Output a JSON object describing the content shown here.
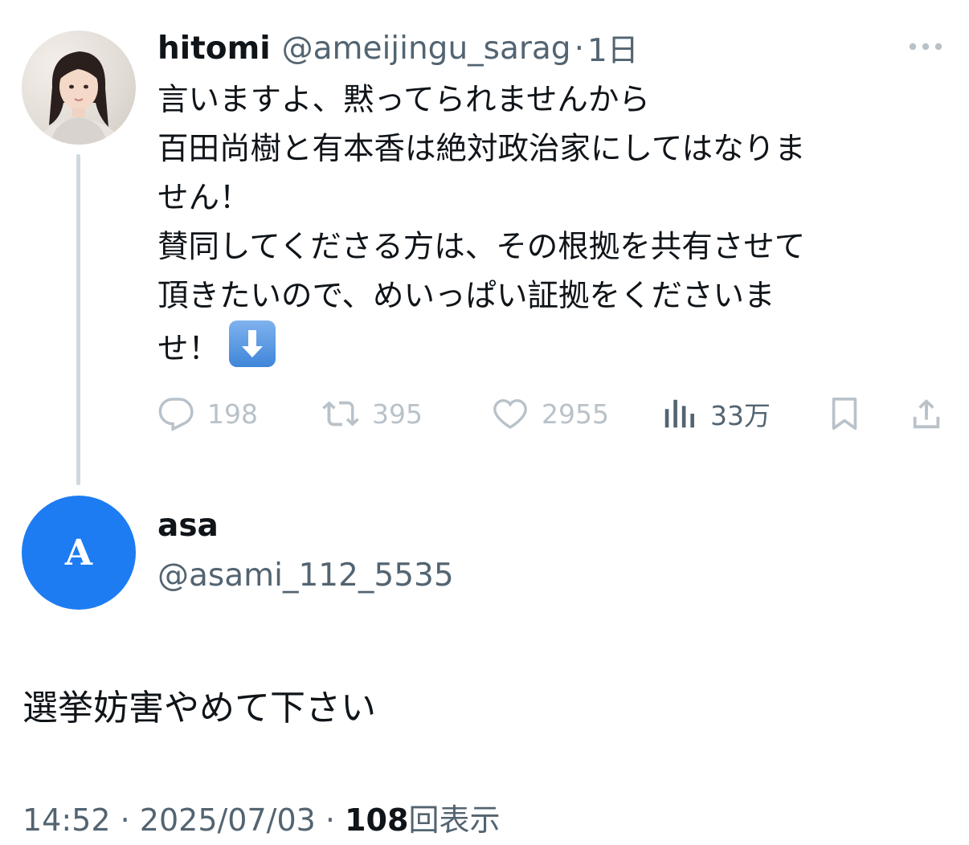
{
  "parent_tweet": {
    "display_name": "hitomi",
    "handle": "@ameijingu_sarag",
    "separator": "·",
    "time": "1日",
    "text_lines": [
      "言いますよ、黙ってられませんから",
      "百田尚樹と有本香は絶対政治家にしてはなりま",
      "せん！",
      "賛同してくださる方は、その根拠を共有させて",
      "頂きたいので、めいっぱい証拠をくださいま",
      "せ！"
    ],
    "emoji": "down-arrow-emoji",
    "actions": {
      "replies": "198",
      "retweets": "395",
      "likes": "2955",
      "views": "33万"
    }
  },
  "reply": {
    "avatar_letter": "A",
    "display_name": "asa",
    "handle": "@asami_112_5535",
    "text": "選挙妨害やめて下さい",
    "time": "14:52",
    "sep1": "·",
    "date": "2025/07/03",
    "sep2": "·",
    "views_count": "108",
    "views_label": "回表示"
  },
  "colors": {
    "text_primary": "#0f1419",
    "text_secondary": "#536471",
    "action_muted": "#b9c2c9",
    "thread_line": "#cfd9de",
    "avatar_blue": "#1d7cf2"
  }
}
